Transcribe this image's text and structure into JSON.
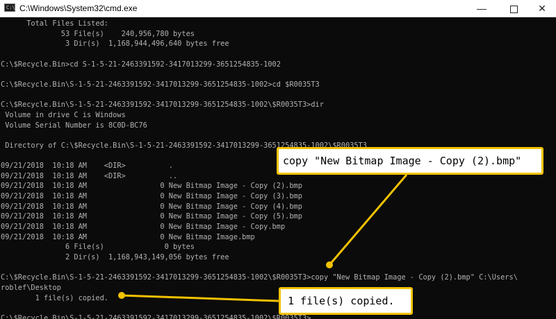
{
  "window": {
    "title": "C:\\Windows\\System32\\cmd.exe",
    "icon": "console-app-icon",
    "minimize_glyph": "—",
    "close_glyph": "✕"
  },
  "console": {
    "lines": [
      "      Total Files Listed:",
      "              53 File(s)    240,956,780 bytes",
      "               3 Dir(s)  1,168,944,496,640 bytes free",
      "",
      "C:\\$Recycle.Bin>cd S-1-5-21-2463391592-3417013299-3651254835-1002",
      "",
      "C:\\$Recycle.Bin\\S-1-5-21-2463391592-3417013299-3651254835-1002>cd $R0035T3",
      "",
      "C:\\$Recycle.Bin\\S-1-5-21-2463391592-3417013299-3651254835-1002\\$R0035T3>dir",
      " Volume in drive C is Windows",
      " Volume Serial Number is 8C0D-BC76",
      "",
      " Directory of C:\\$Recycle.Bin\\S-1-5-21-2463391592-3417013299-3651254835-1002\\$R0035T3",
      "",
      "09/21/2018  10:18 AM    <DIR>          .",
      "09/21/2018  10:18 AM    <DIR>          ..",
      "09/21/2018  10:18 AM                 0 New Bitmap Image - Copy (2).bmp",
      "09/21/2018  10:18 AM                 0 New Bitmap Image - Copy (3).bmp",
      "09/21/2018  10:18 AM                 0 New Bitmap Image - Copy (4).bmp",
      "09/21/2018  10:18 AM                 0 New Bitmap Image - Copy (5).bmp",
      "09/21/2018  10:18 AM                 0 New Bitmap Image - Copy.bmp",
      "09/21/2018  10:18 AM                 0 New Bitmap Image.bmp",
      "               6 File(s)              0 bytes",
      "               2 Dir(s)  1,168,943,149,056 bytes free",
      "",
      "C:\\$Recycle.Bin\\S-1-5-21-2463391592-3417013299-3651254835-1002\\$R0035T3>copy \"New Bitmap Image - Copy (2).bmp\" C:\\Users\\",
      "roblef\\Desktop",
      "        1 file(s) copied.",
      "",
      "C:\\$Recycle.Bin\\S-1-5-21-2463391592-3417013299-3651254835-1002\\$R0035T3>_"
    ]
  },
  "callouts": {
    "command": "copy \"New Bitmap Image - Copy (2).bmp\"",
    "result": "1 file(s) copied."
  },
  "colors": {
    "console_background": "#0c0c0c",
    "console_text": "#c0c0c0",
    "highlight": "#f2c200"
  }
}
